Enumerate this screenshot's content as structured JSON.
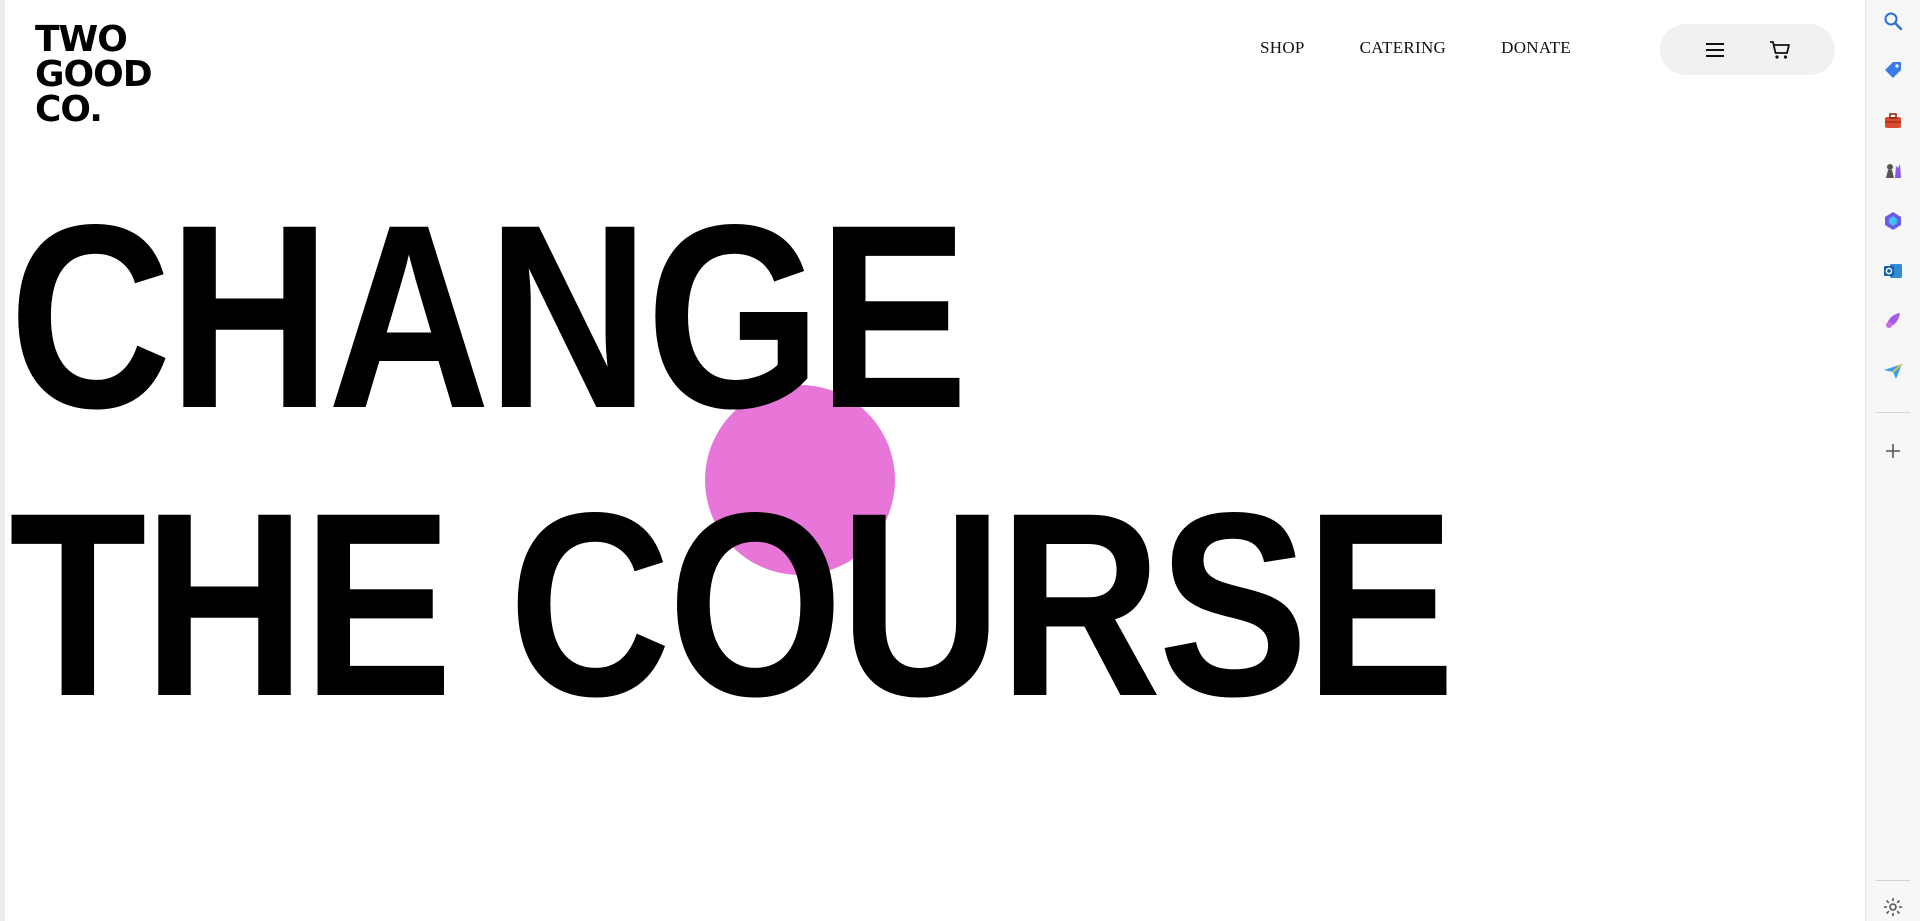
{
  "brand": {
    "logo_lines": [
      "TWO",
      "GOOD",
      "CO."
    ]
  },
  "nav": {
    "shop": "SHOP",
    "catering": "CATERING",
    "donate": "DONATE"
  },
  "nav_icons": {
    "menu": "menu-icon",
    "cart": "cart-icon"
  },
  "hero": {
    "line1": "CHANGE",
    "line2": "THE COURSE",
    "accent_color": "#e876d9"
  },
  "sidebar": {
    "icons": [
      "search-icon",
      "tag-icon",
      "briefcase-icon",
      "chess-icon",
      "copilot-icon",
      "outlook-icon",
      "designer-icon",
      "send-icon",
      "add-icon",
      "settings-icon"
    ]
  }
}
